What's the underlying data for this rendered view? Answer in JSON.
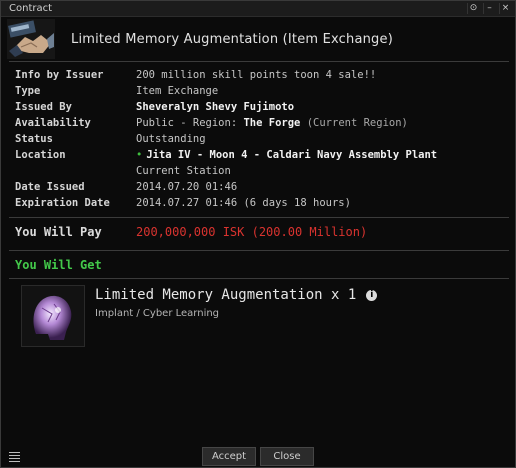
{
  "window": {
    "title": "Contract"
  },
  "contract": {
    "title": "Limited Memory Augmentation (Item Exchange)",
    "fields": {
      "info_by_issuer": {
        "label": "Info by Issuer",
        "value": "200 million skill points toon 4 sale!!"
      },
      "type": {
        "label": "Type",
        "value": "Item Exchange"
      },
      "issued_by": {
        "label": "Issued By",
        "value": "Sheveralyn Shevy Fujimoto"
      },
      "availability": {
        "label": "Availability",
        "prefix": "Public - Region:",
        "region": "The Forge",
        "suffix": "(Current Region)"
      },
      "status": {
        "label": "Status",
        "value": "Outstanding"
      },
      "location": {
        "label": "Location",
        "value": "Jita IV - Moon 4 - Caldari Navy Assembly Plant",
        "sub": "Current Station"
      },
      "date_issued": {
        "label": "Date Issued",
        "value": "2014.07.20 01:46"
      },
      "expiration_date": {
        "label": "Expiration Date",
        "value": "2014.07.27 01:46 (6 days 18 hours)"
      }
    },
    "pay": {
      "label": "You Will Pay",
      "value": "200,000,000 ISK (200.00 Million)"
    },
    "get": {
      "label": "You Will Get",
      "item_name": "Limited Memory Augmentation x 1",
      "item_category": "Implant / Cyber Learning"
    }
  },
  "buttons": {
    "accept": "Accept",
    "close": "Close"
  },
  "icons": {
    "info": "info-icon",
    "settings": "settings-icon",
    "minimize": "minimize-icon",
    "close": "close-icon",
    "menu": "menu-icon"
  },
  "colors": {
    "pay_red": "#d9332f",
    "get_green": "#43c94a",
    "location_dot": "#3fbf3f"
  }
}
